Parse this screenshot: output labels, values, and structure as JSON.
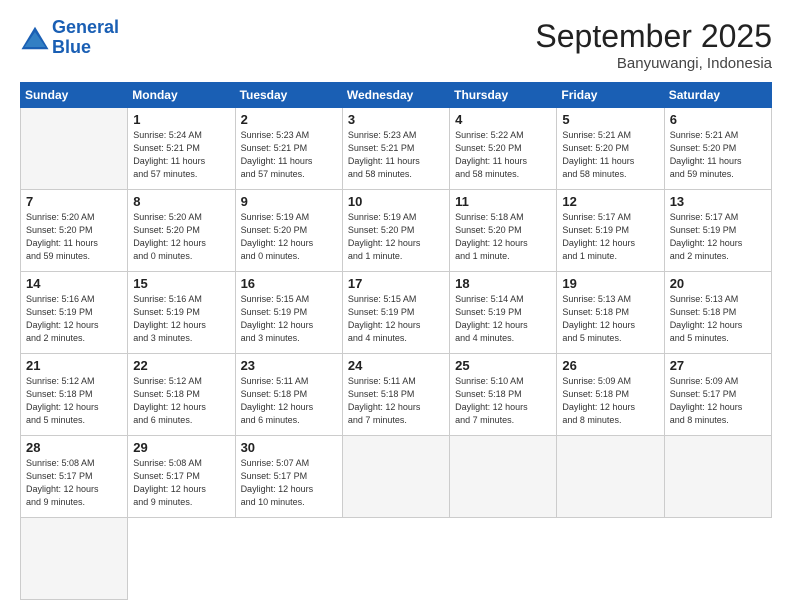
{
  "logo": {
    "line1": "General",
    "line2": "Blue"
  },
  "title": "September 2025",
  "subtitle": "Banyuwangi, Indonesia",
  "weekdays": [
    "Sunday",
    "Monday",
    "Tuesday",
    "Wednesday",
    "Thursday",
    "Friday",
    "Saturday"
  ],
  "days": [
    {
      "date": "",
      "info": ""
    },
    {
      "date": "1",
      "info": "Sunrise: 5:24 AM\nSunset: 5:21 PM\nDaylight: 11 hours\nand 57 minutes."
    },
    {
      "date": "2",
      "info": "Sunrise: 5:23 AM\nSunset: 5:21 PM\nDaylight: 11 hours\nand 57 minutes."
    },
    {
      "date": "3",
      "info": "Sunrise: 5:23 AM\nSunset: 5:21 PM\nDaylight: 11 hours\nand 58 minutes."
    },
    {
      "date": "4",
      "info": "Sunrise: 5:22 AM\nSunset: 5:20 PM\nDaylight: 11 hours\nand 58 minutes."
    },
    {
      "date": "5",
      "info": "Sunrise: 5:21 AM\nSunset: 5:20 PM\nDaylight: 11 hours\nand 58 minutes."
    },
    {
      "date": "6",
      "info": "Sunrise: 5:21 AM\nSunset: 5:20 PM\nDaylight: 11 hours\nand 59 minutes."
    },
    {
      "date": "7",
      "info": "Sunrise: 5:20 AM\nSunset: 5:20 PM\nDaylight: 11 hours\nand 59 minutes."
    },
    {
      "date": "8",
      "info": "Sunrise: 5:20 AM\nSunset: 5:20 PM\nDaylight: 12 hours\nand 0 minutes."
    },
    {
      "date": "9",
      "info": "Sunrise: 5:19 AM\nSunset: 5:20 PM\nDaylight: 12 hours\nand 0 minutes."
    },
    {
      "date": "10",
      "info": "Sunrise: 5:19 AM\nSunset: 5:20 PM\nDaylight: 12 hours\nand 1 minute."
    },
    {
      "date": "11",
      "info": "Sunrise: 5:18 AM\nSunset: 5:20 PM\nDaylight: 12 hours\nand 1 minute."
    },
    {
      "date": "12",
      "info": "Sunrise: 5:17 AM\nSunset: 5:19 PM\nDaylight: 12 hours\nand 1 minute."
    },
    {
      "date": "13",
      "info": "Sunrise: 5:17 AM\nSunset: 5:19 PM\nDaylight: 12 hours\nand 2 minutes."
    },
    {
      "date": "14",
      "info": "Sunrise: 5:16 AM\nSunset: 5:19 PM\nDaylight: 12 hours\nand 2 minutes."
    },
    {
      "date": "15",
      "info": "Sunrise: 5:16 AM\nSunset: 5:19 PM\nDaylight: 12 hours\nand 3 minutes."
    },
    {
      "date": "16",
      "info": "Sunrise: 5:15 AM\nSunset: 5:19 PM\nDaylight: 12 hours\nand 3 minutes."
    },
    {
      "date": "17",
      "info": "Sunrise: 5:15 AM\nSunset: 5:19 PM\nDaylight: 12 hours\nand 4 minutes."
    },
    {
      "date": "18",
      "info": "Sunrise: 5:14 AM\nSunset: 5:19 PM\nDaylight: 12 hours\nand 4 minutes."
    },
    {
      "date": "19",
      "info": "Sunrise: 5:13 AM\nSunset: 5:18 PM\nDaylight: 12 hours\nand 5 minutes."
    },
    {
      "date": "20",
      "info": "Sunrise: 5:13 AM\nSunset: 5:18 PM\nDaylight: 12 hours\nand 5 minutes."
    },
    {
      "date": "21",
      "info": "Sunrise: 5:12 AM\nSunset: 5:18 PM\nDaylight: 12 hours\nand 5 minutes."
    },
    {
      "date": "22",
      "info": "Sunrise: 5:12 AM\nSunset: 5:18 PM\nDaylight: 12 hours\nand 6 minutes."
    },
    {
      "date": "23",
      "info": "Sunrise: 5:11 AM\nSunset: 5:18 PM\nDaylight: 12 hours\nand 6 minutes."
    },
    {
      "date": "24",
      "info": "Sunrise: 5:11 AM\nSunset: 5:18 PM\nDaylight: 12 hours\nand 7 minutes."
    },
    {
      "date": "25",
      "info": "Sunrise: 5:10 AM\nSunset: 5:18 PM\nDaylight: 12 hours\nand 7 minutes."
    },
    {
      "date": "26",
      "info": "Sunrise: 5:09 AM\nSunset: 5:18 PM\nDaylight: 12 hours\nand 8 minutes."
    },
    {
      "date": "27",
      "info": "Sunrise: 5:09 AM\nSunset: 5:17 PM\nDaylight: 12 hours\nand 8 minutes."
    },
    {
      "date": "28",
      "info": "Sunrise: 5:08 AM\nSunset: 5:17 PM\nDaylight: 12 hours\nand 9 minutes."
    },
    {
      "date": "29",
      "info": "Sunrise: 5:08 AM\nSunset: 5:17 PM\nDaylight: 12 hours\nand 9 minutes."
    },
    {
      "date": "30",
      "info": "Sunrise: 5:07 AM\nSunset: 5:17 PM\nDaylight: 12 hours\nand 10 minutes."
    },
    {
      "date": "",
      "info": ""
    },
    {
      "date": "",
      "info": ""
    },
    {
      "date": "",
      "info": ""
    },
    {
      "date": "",
      "info": ""
    },
    {
      "date": "",
      "info": ""
    }
  ]
}
